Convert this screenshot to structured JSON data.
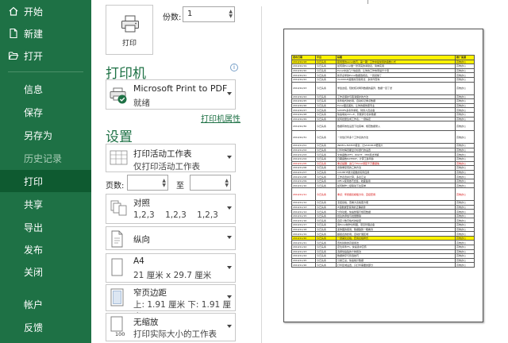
{
  "nav": {
    "items": [
      {
        "label": "开始",
        "icon": "home-icon"
      },
      {
        "label": "新建",
        "icon": "new-file-icon"
      },
      {
        "label": "打开",
        "icon": "folder-open-icon"
      },
      {
        "label": "信息"
      },
      {
        "label": "保存"
      },
      {
        "label": "另存为"
      },
      {
        "label": "历史记录"
      },
      {
        "label": "打印"
      },
      {
        "label": "共享"
      },
      {
        "label": "导出"
      },
      {
        "label": "发布"
      },
      {
        "label": "关闭"
      },
      {
        "label": "帐户"
      },
      {
        "label": "反馈"
      }
    ]
  },
  "print": {
    "button_label": "打印",
    "copies_label": "份数:",
    "copies_value": "1"
  },
  "printer": {
    "section_title": "打印机",
    "name": "Microsoft Print to PDF",
    "status": "就绪",
    "properties_link": "打印机属性",
    "info_icon": "i"
  },
  "settings": {
    "section_title": "设置",
    "what": {
      "title": "打印活动工作表",
      "subtitle": "仅打印活动工作表"
    },
    "pages_label": "页数:",
    "to_label": "至",
    "pages_from": "",
    "pages_to": "",
    "collate": {
      "title": "对照",
      "subtitle": "1,2,3    1,2,3    1,2,3"
    },
    "orientation": {
      "title": "纵向"
    },
    "paper": {
      "title": "A4",
      "subtitle": "21 厘米 x 29.7 厘米"
    },
    "margins": {
      "title": "窄页边距",
      "subtitle": "上: 1.91 厘米 下: 1.91 厘米"
    },
    "scaling": {
      "title": "无缩放",
      "subtitle": "打印实际大小的工作表",
      "badge": "100"
    }
  },
  "preview": {
    "header": [
      "发布日期",
      "平台",
      "标题",
      "推广渠道"
    ],
    "rows": [
      {
        "d": "2019/10/18",
        "p": "今日头条",
        "t": "职场里的excel技巧，第一期：工作中最常用的函数公式",
        "c": "高效办公",
        "style": "hl"
      },
      {
        "d": "2019/10/19",
        "p": "今日头条",
        "t": "如何用Excel做一张漂亮的考勤表，简单实用",
        "c": "高效办公"
      },
      {
        "d": "2019/10/20",
        "p": "今日头条",
        "t": "Excel中这几个快捷键，让你的工作效率提升十倍",
        "c": "高效办公"
      },
      {
        "d": "2019/10/21",
        "p": "今日头条",
        "t": "新手必学的Excel数据透视表，一篇就够了",
        "c": "高效办公"
      },
      {
        "d": "2019/10/22",
        "p": "今日头条",
        "t": "VLOOKUP函数的高级用法，多条件查询",
        "c": "高效办公"
      },
      {
        "d": "2019/10/23",
        "p": "今日头条",
        "t": "学会这招，轻松核对两列数据的差异，数据一目了然",
        "c": "高效办公",
        "style": "tall"
      },
      {
        "d": "2019/10/24",
        "p": "今日头条",
        "t": "工作表保护与取消保护的方法",
        "c": "高效办公"
      },
      {
        "d": "2019/10/25",
        "p": "今日头条",
        "t": "条件格式的妙用，自动标记重点数据",
        "c": "高效办公"
      },
      {
        "d": "2019/10/26",
        "p": "今日头条",
        "t": "Excel图表美化，让你的报告更专业",
        "c": "高效办公"
      },
      {
        "d": "2019/10/27",
        "p": "今日头条",
        "t": "SUMIFS多条件求和，财务人员必备",
        "c": "高效办公"
      },
      {
        "d": "2019/10/28",
        "p": "今日头条",
        "t": "快速填充Ctrl+E，智能拆分合并数据",
        "c": "高效办公"
      },
      {
        "d": "2019/10/29",
        "p": "今日头条",
        "t": "如何批量生成工作表，一键搞定",
        "c": "高效办公"
      },
      {
        "d": "2019/10/30",
        "p": "今日头条",
        "t": "数据有效性设置下拉菜单，规范数据录入",
        "c": "高效办公",
        "style": "tall2"
      },
      {
        "d": "2019/10/31",
        "p": "今日头条",
        "t": "一次性打印多个工作表的方法",
        "c": "高效办公",
        "style": "tall"
      },
      {
        "d": "2019/11/01",
        "p": "今日头条",
        "t": "INDEX+MATCH组合，比VLOOKUP更强大",
        "c": "高效办公"
      },
      {
        "d": "2019/11/02",
        "p": "今日头条",
        "t": "打印时每页都显示标题行的设置",
        "c": "高效办公"
      },
      {
        "d": "2019/11/03",
        "p": "今日头条",
        "t": "文本函数LEFT、RIGHT、MID用法详解",
        "c": "高效办公"
      },
      {
        "d": "2019/11/04",
        "p": "今日头条",
        "t": "日期函数DATEDIF，计算工龄年龄",
        "c": "高效办公"
      },
      {
        "d": "2019/11/05",
        "p": "今日头条",
        "t": "重点提醒：这几个Excel误区千万要避免",
        "c": "高效办公",
        "style": "red"
      },
      {
        "d": "2019/11/06",
        "p": "今日头条",
        "t": "去除重复值的三种方法",
        "c": "高效办公"
      },
      {
        "d": "2019/11/07",
        "p": "今日头条",
        "t": "COUNTIF统计函数的实际应用",
        "c": "高效办公"
      },
      {
        "d": "2019/11/08",
        "p": "今日头条",
        "t": "工作表合并计算，多表汇总",
        "c": "高效办公"
      },
      {
        "d": "2019/11/09",
        "p": "今日头条",
        "t": "Office使用技巧合集，收藏备用",
        "c": "高效办公"
      },
      {
        "d": "2019/11/10",
        "p": "今日头条",
        "t": "如何制作二级联动下拉菜单",
        "c": "高效办公"
      },
      {
        "d": "2019/11/11",
        "p": "今日头条",
        "t": "重点：年终报表模板分享，直接套用",
        "c": "高效办公",
        "style": "red tall"
      },
      {
        "d": "2019/11/12",
        "p": "今日头条",
        "t": "冻结窗格，查看大表格更方便",
        "c": "高效办公"
      },
      {
        "d": "2019/11/13",
        "p": "今日头条",
        "t": "IF函数嵌套使用的正确姿势",
        "c": "高效办公"
      },
      {
        "d": "2019/11/14",
        "p": "今日头条",
        "t": "分列功能，快速整理不规范数据",
        "c": "高效办公"
      },
      {
        "d": "2019/11/15",
        "p": "今日头条",
        "t": "批注的添加与批量删除",
        "c": "高效办公"
      },
      {
        "d": "2019/11/16",
        "p": "今日头条",
        "t": "自定义数字格式的秘密",
        "c": "高效办公"
      },
      {
        "d": "2019/11/17",
        "p": "今日头条",
        "t": "用Excel制作甘特图，项目管理必备",
        "c": "高效办公"
      },
      {
        "d": "2019/11/18",
        "p": "今日头条",
        "t": "迷你图的使用，数据趋势一眼看清",
        "c": "高效办公"
      },
      {
        "d": "2019/11/19",
        "p": "今日头条",
        "t": "超级表的妙用，自动扩展区域",
        "c": "高效办公"
      },
      {
        "d": "2019/11/20",
        "p": "今日头条",
        "t": "一键美化表格，套用表格样式",
        "c": "高效办公",
        "style": "hl"
      },
      {
        "d": "2019/11/21",
        "p": "今日头条",
        "t": "查找替换的高级用法",
        "c": "高效办公"
      },
      {
        "d": "2019/11/22",
        "p": "今日头条",
        "t": "定位条件F5，快速选中空值",
        "c": "高效办公"
      },
      {
        "d": "2019/11/23",
        "p": "今日头条",
        "t": "选择性粘贴的十种用法",
        "c": "高效办公"
      },
      {
        "d": "2019/11/24",
        "p": "今日头条",
        "t": "数据排序与筛选技巧",
        "c": "高效办公"
      },
      {
        "d": "2019/11/25",
        "p": "今日头条",
        "t": "分类汇总，快速统计数据",
        "c": "高效办公"
      },
      {
        "d": "2019/11/26",
        "p": "今日头条",
        "t": "打印区域设置，只打印需要的部分",
        "c": "高效办公"
      }
    ]
  }
}
